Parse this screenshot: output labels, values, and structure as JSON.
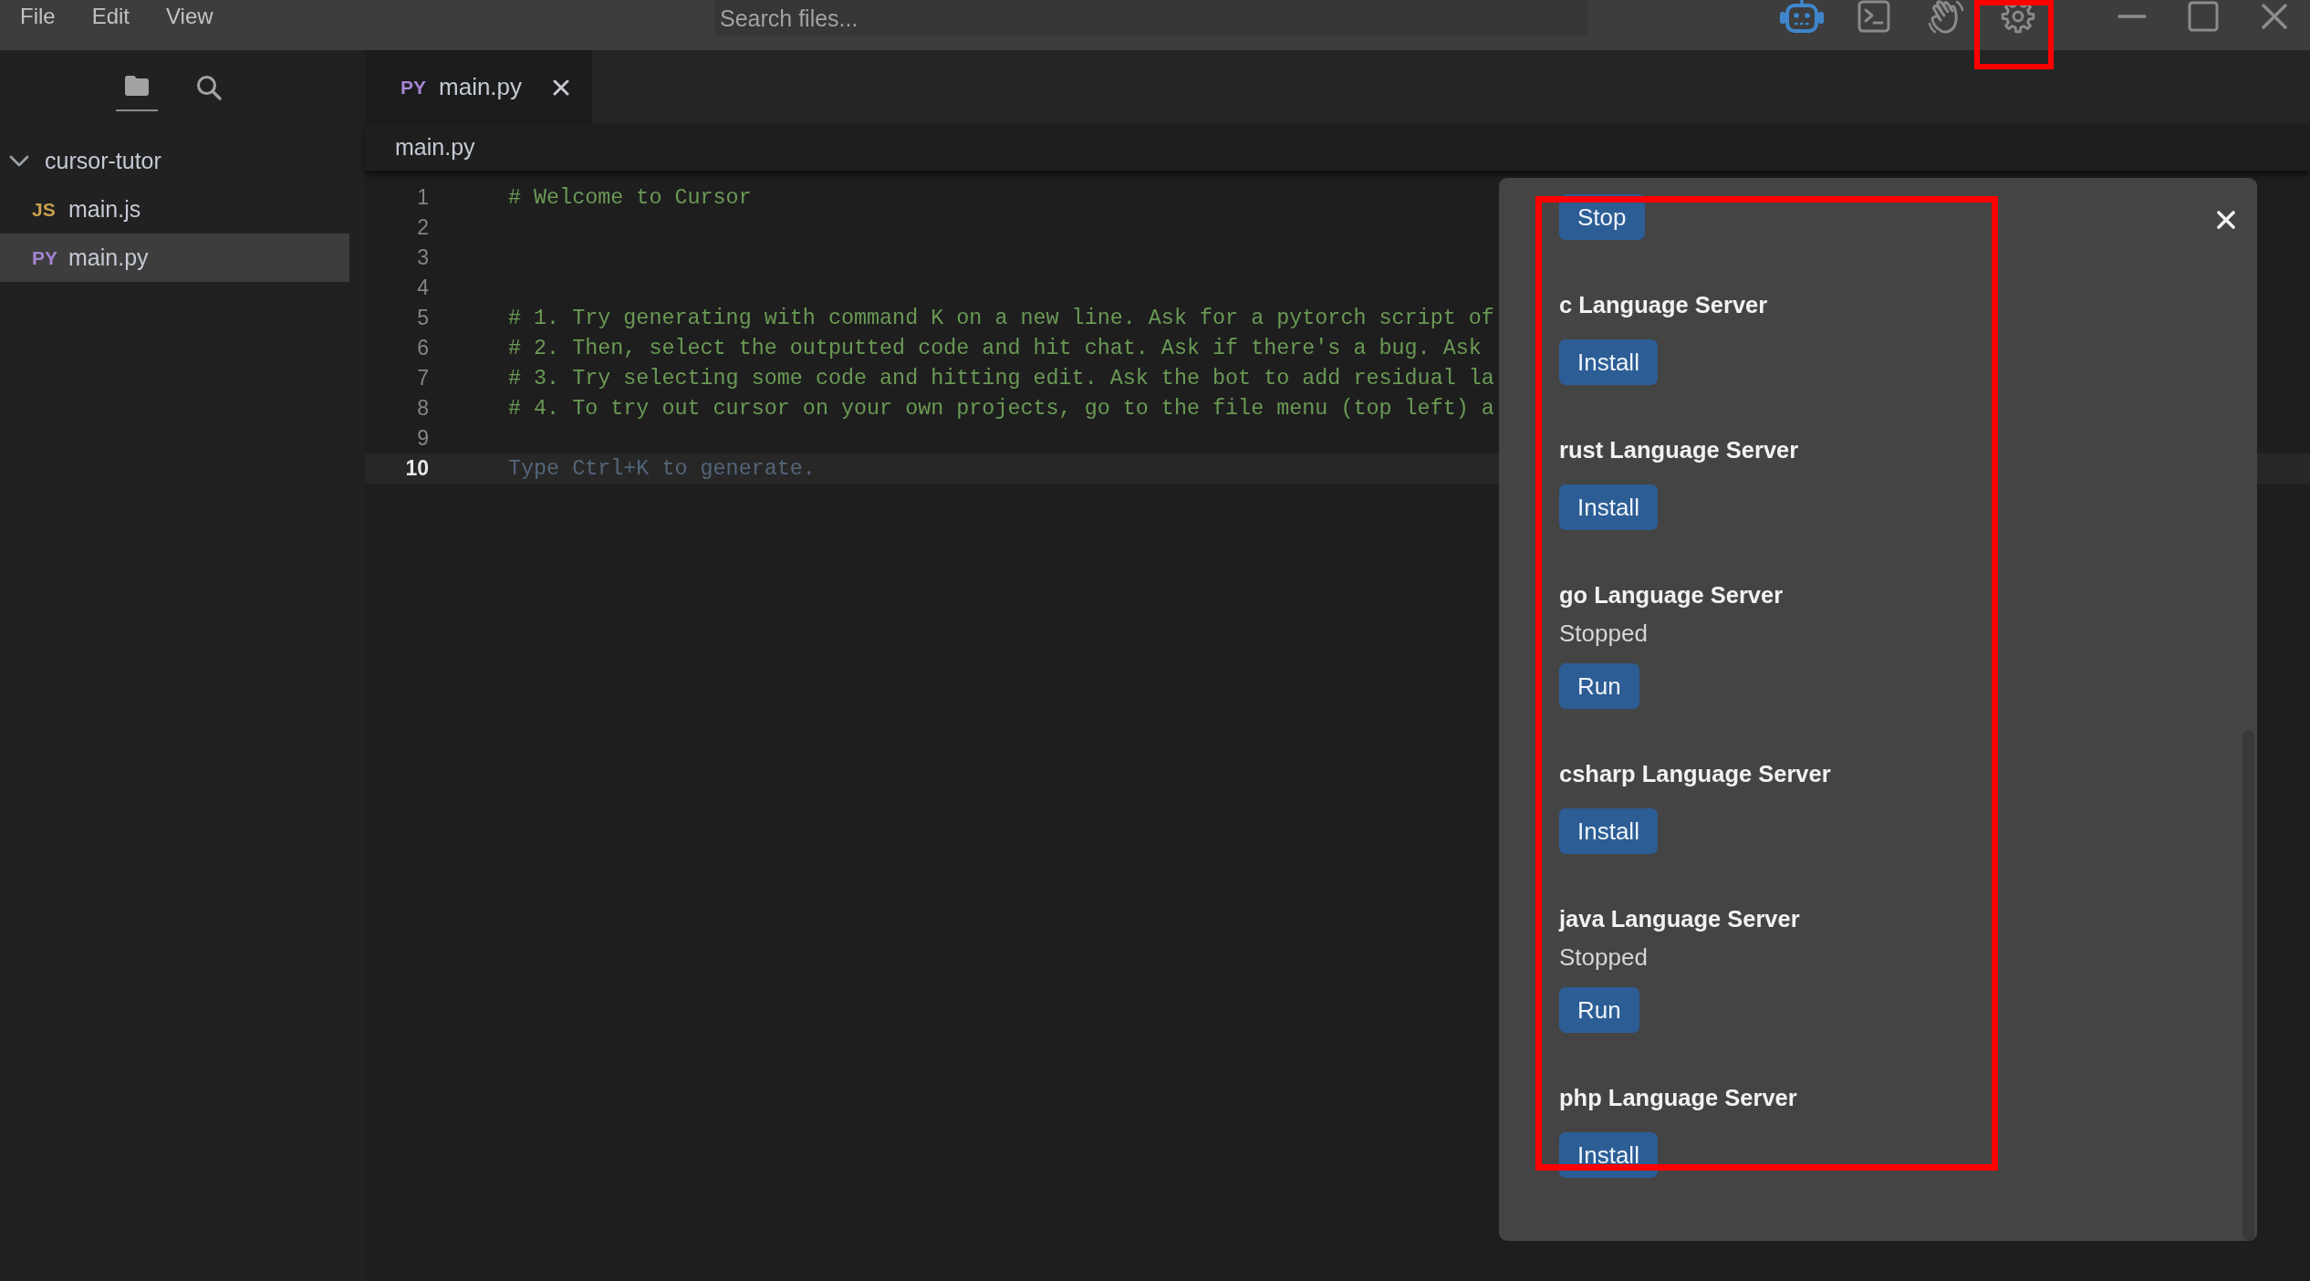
{
  "title_bar": {
    "menu": [
      "File",
      "Edit",
      "View"
    ],
    "search": {
      "placeholder": "Search files..."
    },
    "tools": [
      {
        "kind": "robot",
        "active": true
      },
      {
        "kind": "terminal",
        "active": false
      },
      {
        "kind": "hand",
        "active": false
      },
      {
        "kind": "gear",
        "active": false
      }
    ]
  },
  "sidebar": {
    "tabs": [
      {
        "kind": "files",
        "selected": true
      },
      {
        "kind": "search",
        "selected": false
      }
    ],
    "tree": [
      {
        "label": "cursor-tutor",
        "expanded": true,
        "children": [
          {
            "badge": "JS",
            "label": "main.js",
            "color": "#c9a24e",
            "selected": false
          },
          {
            "badge": "PY",
            "label": "main.py",
            "color": "#a584d4",
            "selected": true
          }
        ]
      }
    ]
  },
  "tabs": [
    {
      "badge": "PY",
      "label": "main.py",
      "color": "#a584d4",
      "selected": true
    }
  ],
  "breadcrumb": "main.py",
  "editor": {
    "lines": [
      {
        "number": "1",
        "kind": "comment",
        "text": "# Welcome to Cursor",
        "current": false
      },
      {
        "number": "2",
        "kind": "blank",
        "current": false
      },
      {
        "number": "3",
        "kind": "blank",
        "current": false
      },
      {
        "number": "4",
        "kind": "blank",
        "current": false
      },
      {
        "number": "5",
        "kind": "comment",
        "text": "# 1. Try generating with command K on a new line. Ask for a pytorch script of",
        "current": false
      },
      {
        "number": "6",
        "kind": "comment",
        "text": "# 2. Then, select the outputted code and hit chat. Ask if there's a bug. Ask",
        "current": false
      },
      {
        "number": "7",
        "kind": "comment",
        "text": "# 3. Try selecting some code and hitting edit. Ask the bot to add residual la",
        "current": false
      },
      {
        "number": "8",
        "kind": "comment",
        "text": "# 4. To try out cursor on your own projects, go to the file menu (top left) a",
        "current": false
      },
      {
        "number": "9",
        "kind": "blank",
        "current": false
      },
      {
        "number": "10",
        "kind": "hint",
        "text": "Type Ctrl+K to generate.",
        "current": true
      }
    ]
  },
  "panel": {
    "servers": [
      {
        "button": "Stop"
      },
      {
        "name": "c Language Server",
        "button": "Install"
      },
      {
        "name": "rust Language Server",
        "button": "Install"
      },
      {
        "name": "go Language Server",
        "status": "Stopped",
        "button": "Run"
      },
      {
        "name": "csharp Language Server",
        "button": "Install"
      },
      {
        "name": "java Language Server",
        "status": "Stopped",
        "button": "Run"
      },
      {
        "name": "php Language Server",
        "button": "Install"
      }
    ]
  }
}
